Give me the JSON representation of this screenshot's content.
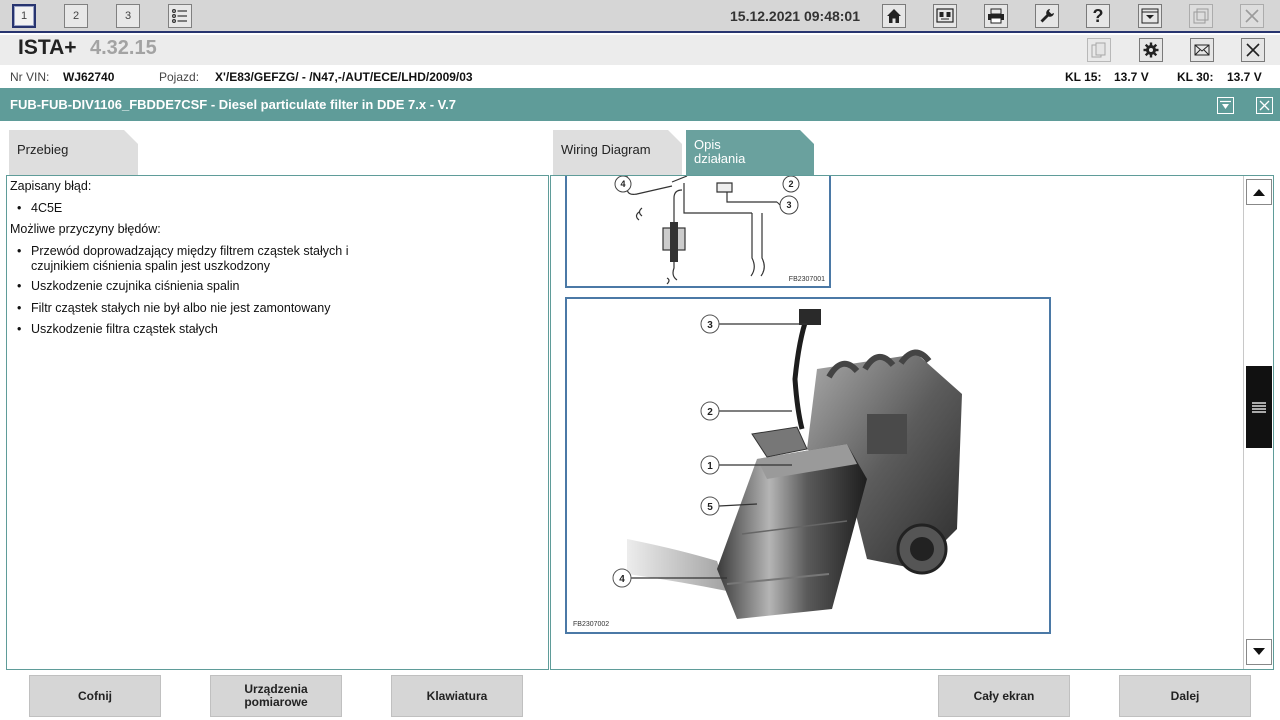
{
  "topbar": {
    "sessions": [
      "1",
      "2",
      "3"
    ],
    "datetime": "15.12.2021 09:48:01",
    "icons": [
      "home-icon",
      "car-data-icon",
      "print-icon",
      "wrench-icon",
      "help-icon",
      "measure-icon",
      "window-icon",
      "close-icon"
    ]
  },
  "app": {
    "name": "ISTA+",
    "version": "4.32.15"
  },
  "vehicle": {
    "vin_label": "Nr VIN:",
    "vin": "WJ62740",
    "vehicle_label": "Pojazd:",
    "vehicle": "X'/E83/GEFZG/ - /N47,-/AUT/ECE/LHD/2009/03",
    "kl15_label": "KL 15:",
    "kl15": "13.7 V",
    "kl30_label": "KL 30:",
    "kl30": "13.7 V"
  },
  "header": {
    "title": "FUB-FUB-DIV1106_FBDDE7CSF - Diesel particulate filter in DDE 7.x - V.7"
  },
  "tabs": {
    "left": "Przebieg",
    "wiring": "Wiring Diagram",
    "opis_line1": "Opis",
    "opis_line2": "działania"
  },
  "content": {
    "stored_fault_label": "Zapisany błąd:",
    "fault_code": "4C5E",
    "causes_label": "Możliwe przyczyny błędów:",
    "causes": [
      [
        "Przewód doprowadzający między filtrem cząstek stałych i",
        "czujnikiem ciśnienia spalin jest uszkodzony"
      ],
      [
        "Uszkodzenie czujnika ciśnienia spalin"
      ],
      [
        "Filtr cząstek stałych nie był albo nie jest zamontowany"
      ],
      [
        "Uszkodzenie filtra cząstek stałych"
      ]
    ]
  },
  "figures": {
    "fig1_code": "FB2307001",
    "fig2_code": "FB2307002",
    "fig1_callouts": [
      "4",
      "2",
      "3"
    ],
    "fig2_callouts": [
      "3",
      "2",
      "1",
      "5",
      "4"
    ]
  },
  "buttons": {
    "back": "Cofnij",
    "devices_line1": "Urządzenia",
    "devices_line2": "pomiarowe",
    "keyboard": "Klawiatura",
    "fullscreen": "Cały ekran",
    "next": "Dalej"
  },
  "colors": {
    "header_teal": "#5f9c99",
    "active_tab": "#6aa19e",
    "navy": "#27346f",
    "figure_border": "#4b79a6"
  }
}
